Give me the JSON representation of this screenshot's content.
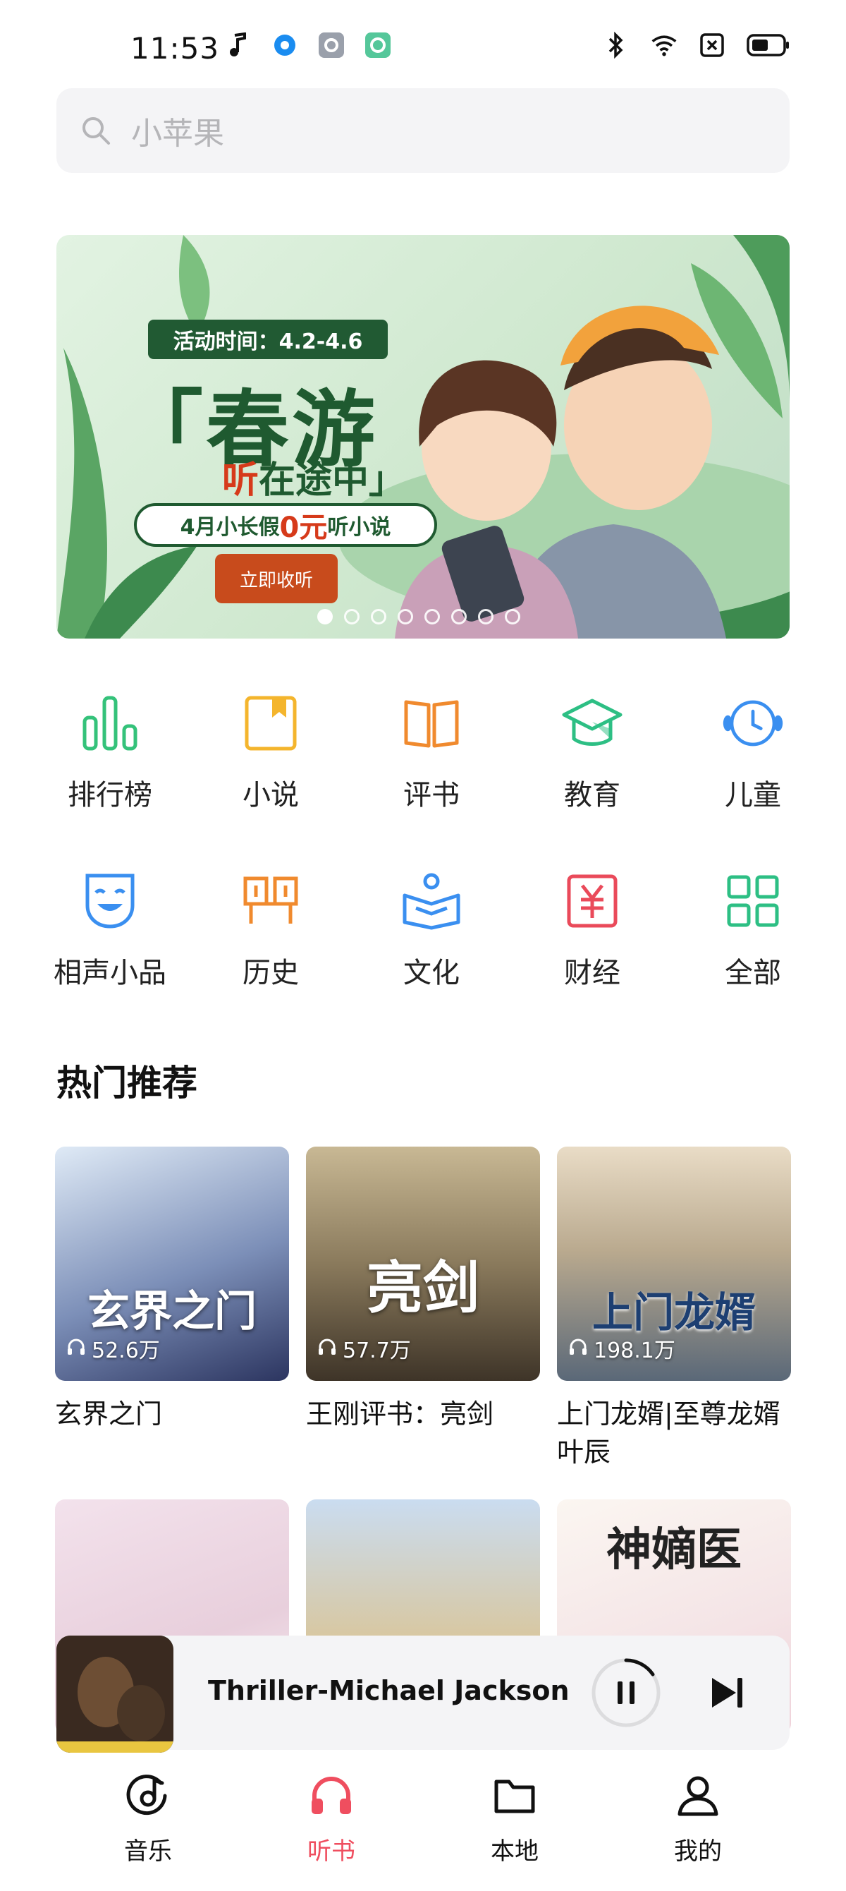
{
  "status_bar": {
    "time": "11:53",
    "icons_left": [
      "music-note-icon",
      "blue-dot-app-icon",
      "gear-app-icon",
      "green-ring-app-icon"
    ],
    "icons_right": [
      "bluetooth-icon",
      "wifi-icon",
      "no-sim-icon",
      "battery-icon"
    ]
  },
  "search": {
    "placeholder": "小苹果"
  },
  "banner": {
    "time_text": "活动时间：4.2-4.6",
    "title": "「春游",
    "subtitle_prefix": "听",
    "subtitle_suffix": "在途中」",
    "free_text_prefix": "4月小长假",
    "free_zero": "0元",
    "free_text_suffix": "听小说",
    "button": "立即收听",
    "dots_total": 8,
    "dots_active_index": 0
  },
  "categories": [
    {
      "label": "排行榜",
      "icon": "ranking-bars-icon",
      "color": "#34c27a"
    },
    {
      "label": "小说",
      "icon": "book-bookmark-icon",
      "color": "#f4b52d"
    },
    {
      "label": "评书",
      "icon": "open-book-icon",
      "color": "#f08a2e"
    },
    {
      "label": "教育",
      "icon": "graduation-cap-icon",
      "color": "#2dbf84"
    },
    {
      "label": "儿童",
      "icon": "alarm-clock-icon",
      "color": "#3a8ff0"
    },
    {
      "label": "相声小品",
      "icon": "smile-mask-icon",
      "color": "#3a8ff0"
    },
    {
      "label": "历史",
      "icon": "history-gate-icon",
      "color": "#f08a2e"
    },
    {
      "label": "文化",
      "icon": "reading-person-icon",
      "color": "#3a8ff0"
    },
    {
      "label": "财经",
      "icon": "yuan-icon",
      "color": "#ea4a5a"
    },
    {
      "label": "全部",
      "icon": "grid-icon",
      "color": "#2dbf84"
    }
  ],
  "section": {
    "title": "热门推荐"
  },
  "books": [
    {
      "title": "玄界之门",
      "cover_text": "玄界之门",
      "plays": "52.6万",
      "bg1": "#cfe0f2",
      "bg2": "#3d4a78"
    },
    {
      "title": "王刚评书：亮剑",
      "cover_text": "亮剑",
      "plays": "57.7万",
      "bg1": "#b8a88a",
      "bg2": "#4a4034"
    },
    {
      "title": "上门龙婿|至尊龙婿叶辰",
      "cover_text": "上门龙婿",
      "plays": "198.1万",
      "bg1": "#e8d8c0",
      "bg2": "#6a7a8a"
    },
    {
      "title": "",
      "cover_text": "",
      "plays": "",
      "bg1": "#f1dde8",
      "bg2": "#f7eef3"
    },
    {
      "title": "",
      "cover_text": "",
      "plays": "",
      "bg1": "#c7dbf0",
      "bg2": "#e0b060"
    },
    {
      "title": "",
      "cover_text": "神嫡医",
      "plays": "",
      "bg1": "#f8f2ec",
      "bg2": "#f0d8dc"
    }
  ],
  "player": {
    "track": "Thriller-Michael Jackson"
  },
  "tabs": [
    {
      "label": "音乐",
      "icon": "music-disc-icon",
      "active": false
    },
    {
      "label": "听书",
      "icon": "headphones-icon",
      "active": true
    },
    {
      "label": "本地",
      "icon": "folder-icon",
      "active": false
    },
    {
      "label": "我的",
      "icon": "person-icon",
      "active": false
    }
  ],
  "colors": {
    "accent": "#ef4e5f",
    "banner_green": "#1f5a30"
  }
}
